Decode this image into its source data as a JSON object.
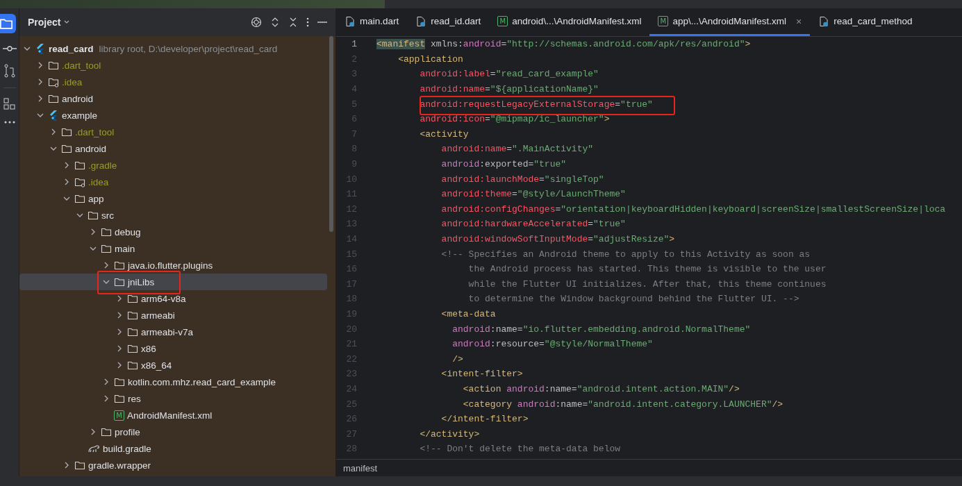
{
  "project_panel": {
    "title": "Project",
    "tree": [
      {
        "label": "read_card",
        "kind": "flutter",
        "detail": "library root, D:\\developer\\project\\read_card",
        "excluded": false,
        "expanded": true,
        "selected": false,
        "annotated": false,
        "children": [
          {
            "label": ".dart_tool",
            "kind": "folder",
            "excluded": true,
            "expanded": false,
            "selected": false,
            "annotated": false
          },
          {
            "label": ".idea",
            "kind": "folder-config",
            "excluded": true,
            "expanded": false,
            "selected": false,
            "annotated": false
          },
          {
            "label": "android",
            "kind": "folder",
            "excluded": false,
            "expanded": false,
            "selected": false,
            "annotated": false
          },
          {
            "label": "example",
            "kind": "flutter",
            "excluded": false,
            "expanded": true,
            "selected": false,
            "annotated": false,
            "children": [
              {
                "label": ".dart_tool",
                "kind": "folder",
                "excluded": true,
                "expanded": false,
                "selected": false,
                "annotated": false
              },
              {
                "label": "android",
                "kind": "folder",
                "excluded": false,
                "expanded": true,
                "selected": false,
                "annotated": false,
                "children": [
                  {
                    "label": ".gradle",
                    "kind": "folder",
                    "excluded": true,
                    "expanded": false,
                    "selected": false,
                    "annotated": false
                  },
                  {
                    "label": ".idea",
                    "kind": "folder-config",
                    "excluded": true,
                    "expanded": false,
                    "selected": false,
                    "annotated": false
                  },
                  {
                    "label": "app",
                    "kind": "folder",
                    "excluded": false,
                    "expanded": true,
                    "selected": false,
                    "annotated": false,
                    "children": [
                      {
                        "label": "src",
                        "kind": "folder",
                        "excluded": false,
                        "expanded": true,
                        "selected": false,
                        "annotated": false,
                        "children": [
                          {
                            "label": "debug",
                            "kind": "folder",
                            "excluded": false,
                            "expanded": false,
                            "selected": false,
                            "annotated": false
                          },
                          {
                            "label": "main",
                            "kind": "folder",
                            "excluded": false,
                            "expanded": true,
                            "selected": false,
                            "annotated": false,
                            "children": [
                              {
                                "label": "java.io.flutter.plugins",
                                "kind": "folder",
                                "excluded": false,
                                "expanded": false,
                                "selected": false,
                                "annotated": false
                              },
                              {
                                "label": "jniLibs",
                                "kind": "folder",
                                "excluded": false,
                                "expanded": true,
                                "selected": true,
                                "annotated": true,
                                "children": [
                                  {
                                    "label": "arm64-v8a",
                                    "kind": "folder",
                                    "excluded": false,
                                    "expanded": false,
                                    "selected": false,
                                    "annotated": false
                                  },
                                  {
                                    "label": "armeabi",
                                    "kind": "folder",
                                    "excluded": false,
                                    "expanded": false,
                                    "selected": false,
                                    "annotated": false
                                  },
                                  {
                                    "label": "armeabi-v7a",
                                    "kind": "folder",
                                    "excluded": false,
                                    "expanded": false,
                                    "selected": false,
                                    "annotated": false
                                  },
                                  {
                                    "label": "x86",
                                    "kind": "folder",
                                    "excluded": false,
                                    "expanded": false,
                                    "selected": false,
                                    "annotated": false
                                  },
                                  {
                                    "label": "x86_64",
                                    "kind": "folder",
                                    "excluded": false,
                                    "expanded": false,
                                    "selected": false,
                                    "annotated": false
                                  }
                                ]
                              },
                              {
                                "label": "kotlin.com.mhz.read_card_example",
                                "kind": "folder",
                                "excluded": false,
                                "expanded": false,
                                "selected": false,
                                "annotated": false
                              },
                              {
                                "label": "res",
                                "kind": "folder",
                                "excluded": false,
                                "expanded": false,
                                "selected": false,
                                "annotated": false
                              },
                              {
                                "label": "AndroidManifest.xml",
                                "kind": "manifest",
                                "badge": "M",
                                "excluded": false,
                                "selected": false,
                                "annotated": false
                              }
                            ]
                          },
                          {
                            "label": "profile",
                            "kind": "folder",
                            "excluded": false,
                            "expanded": false,
                            "selected": false,
                            "annotated": false
                          }
                        ]
                      },
                      {
                        "label": "build.gradle",
                        "kind": "gradle",
                        "excluded": false,
                        "selected": false,
                        "annotated": false
                      }
                    ]
                  },
                  {
                    "label": "gradle.wrapper",
                    "kind": "folder",
                    "excluded": false,
                    "expanded": false,
                    "selected": false,
                    "annotated": false
                  }
                ]
              }
            ]
          }
        ]
      }
    ]
  },
  "editor_tabs": [
    {
      "label": "main.dart",
      "kind": "dart",
      "selected": false
    },
    {
      "label": "read_id.dart",
      "kind": "dart",
      "selected": false
    },
    {
      "label": "android\\...\\AndroidManifest.xml",
      "kind": "manifest",
      "badge": "M",
      "selected": false
    },
    {
      "label": "app\\...\\AndroidManifest.xml",
      "kind": "manifest",
      "badge": "M",
      "selected": true,
      "close": "×"
    },
    {
      "label": "read_card_method",
      "kind": "dart",
      "selected": false
    }
  ],
  "code_lines": [
    {
      "number": "1",
      "current": true,
      "annotated": false,
      "tokens": [
        {
          "kind": "tagm",
          "text": "<manifest"
        },
        {
          "kind": "plain",
          "text": " xmlns:"
        },
        {
          "kind": "ns",
          "text": "android"
        },
        {
          "kind": "plain",
          "text": "="
        },
        {
          "kind": "str",
          "text": "\"http://schemas.android.com/apk/res/android\""
        },
        {
          "kind": "tag",
          "text": ">"
        }
      ]
    },
    {
      "number": "2",
      "current": false,
      "annotated": false,
      "tokens": [
        {
          "kind": "tag",
          "text": "    <application"
        }
      ]
    },
    {
      "number": "3",
      "current": false,
      "annotated": false,
      "tokens": [
        {
          "kind": "err",
          "text": "        android:label"
        },
        {
          "kind": "plain",
          "text": "="
        },
        {
          "kind": "str",
          "text": "\"read_card_example\""
        }
      ]
    },
    {
      "number": "4",
      "current": false,
      "annotated": false,
      "tokens": [
        {
          "kind": "err",
          "text": "        android:name"
        },
        {
          "kind": "plain",
          "text": "="
        },
        {
          "kind": "str",
          "text": "\"${applicationName}\""
        }
      ]
    },
    {
      "number": "5",
      "current": false,
      "annotated": true,
      "tokens": [
        {
          "kind": "err",
          "text": "        android:requestLegacyExternalStorage"
        },
        {
          "kind": "plain",
          "text": "="
        },
        {
          "kind": "str",
          "text": "\"true\""
        }
      ]
    },
    {
      "number": "6",
      "current": false,
      "annotated": false,
      "tokens": [
        {
          "kind": "err",
          "text": "        android:icon"
        },
        {
          "kind": "plain",
          "text": "="
        },
        {
          "kind": "str",
          "text": "\"@mipmap/ic_launcher\""
        },
        {
          "kind": "tag",
          "text": ">"
        }
      ]
    },
    {
      "number": "7",
      "current": false,
      "annotated": false,
      "tokens": [
        {
          "kind": "tag",
          "text": "        <activity"
        }
      ]
    },
    {
      "number": "8",
      "current": false,
      "annotated": false,
      "tokens": [
        {
          "kind": "err",
          "text": "            android:name"
        },
        {
          "kind": "plain",
          "text": "="
        },
        {
          "kind": "str",
          "text": "\".MainActivity\""
        }
      ]
    },
    {
      "number": "9",
      "current": false,
      "annotated": false,
      "tokens": [
        {
          "kind": "ns",
          "text": "            android"
        },
        {
          "kind": "plain",
          "text": ":exported="
        },
        {
          "kind": "str",
          "text": "\"true\""
        }
      ]
    },
    {
      "number": "10",
      "current": false,
      "annotated": false,
      "tokens": [
        {
          "kind": "err",
          "text": "            android:launchMode"
        },
        {
          "kind": "plain",
          "text": "="
        },
        {
          "kind": "str",
          "text": "\"singleTop\""
        }
      ]
    },
    {
      "number": "11",
      "current": false,
      "annotated": false,
      "tokens": [
        {
          "kind": "err",
          "text": "            android:theme"
        },
        {
          "kind": "plain",
          "text": "="
        },
        {
          "kind": "str",
          "text": "\"@style/LaunchTheme\""
        }
      ]
    },
    {
      "number": "12",
      "current": false,
      "annotated": false,
      "tokens": [
        {
          "kind": "err",
          "text": "            android:configChanges"
        },
        {
          "kind": "plain",
          "text": "="
        },
        {
          "kind": "str",
          "text": "\"orientation|keyboardHidden|keyboard|screenSize|smallestScreenSize|loca"
        }
      ]
    },
    {
      "number": "13",
      "current": false,
      "annotated": false,
      "tokens": [
        {
          "kind": "err",
          "text": "            android:hardwareAccelerated"
        },
        {
          "kind": "plain",
          "text": "="
        },
        {
          "kind": "str",
          "text": "\"true\""
        }
      ]
    },
    {
      "number": "14",
      "current": false,
      "annotated": false,
      "tokens": [
        {
          "kind": "err",
          "text": "            android:windowSoftInputMode"
        },
        {
          "kind": "plain",
          "text": "="
        },
        {
          "kind": "str",
          "text": "\"adjustResize\""
        },
        {
          "kind": "tag",
          "text": ">"
        }
      ]
    },
    {
      "number": "15",
      "current": false,
      "annotated": false,
      "tokens": [
        {
          "kind": "comment",
          "text": "            <!-- Specifies an Android theme to apply to this Activity as soon as"
        }
      ]
    },
    {
      "number": "16",
      "current": false,
      "annotated": false,
      "tokens": [
        {
          "kind": "comment",
          "text": "                 the Android process has started. This theme is visible to the user"
        }
      ]
    },
    {
      "number": "17",
      "current": false,
      "annotated": false,
      "tokens": [
        {
          "kind": "comment",
          "text": "                 while the Flutter UI initializes. After that, this theme continues"
        }
      ]
    },
    {
      "number": "18",
      "current": false,
      "annotated": false,
      "tokens": [
        {
          "kind": "comment",
          "text": "                 to determine the Window background behind the Flutter UI. -->"
        }
      ]
    },
    {
      "number": "19",
      "current": false,
      "annotated": false,
      "tokens": [
        {
          "kind": "tag",
          "text": "            <meta-data"
        }
      ]
    },
    {
      "number": "20",
      "current": false,
      "annotated": false,
      "tokens": [
        {
          "kind": "ns",
          "text": "              android"
        },
        {
          "kind": "plain",
          "text": ":name="
        },
        {
          "kind": "str",
          "text": "\"io.flutter.embedding.android.NormalTheme\""
        }
      ]
    },
    {
      "number": "21",
      "current": false,
      "annotated": false,
      "tokens": [
        {
          "kind": "ns",
          "text": "              android"
        },
        {
          "kind": "plain",
          "text": ":resource="
        },
        {
          "kind": "str",
          "text": "\"@style/NormalTheme\""
        }
      ]
    },
    {
      "number": "22",
      "current": false,
      "annotated": false,
      "tokens": [
        {
          "kind": "tag",
          "text": "              />"
        }
      ]
    },
    {
      "number": "23",
      "current": false,
      "annotated": false,
      "tokens": [
        {
          "kind": "tag",
          "text": "            <intent-filter>"
        }
      ]
    },
    {
      "number": "24",
      "current": false,
      "annotated": false,
      "tokens": [
        {
          "kind": "tag",
          "text": "                <action "
        },
        {
          "kind": "ns",
          "text": "android"
        },
        {
          "kind": "plain",
          "text": ":name="
        },
        {
          "kind": "str",
          "text": "\"android.intent.action.MAIN\""
        },
        {
          "kind": "tag",
          "text": "/>"
        }
      ]
    },
    {
      "number": "25",
      "current": false,
      "annotated": false,
      "tokens": [
        {
          "kind": "tag",
          "text": "                <category "
        },
        {
          "kind": "ns",
          "text": "android"
        },
        {
          "kind": "plain",
          "text": ":name="
        },
        {
          "kind": "str",
          "text": "\"android.intent.category.LAUNCHER\""
        },
        {
          "kind": "tag",
          "text": "/>"
        }
      ]
    },
    {
      "number": "26",
      "current": false,
      "annotated": false,
      "tokens": [
        {
          "kind": "tag",
          "text": "            </intent-filter>"
        }
      ]
    },
    {
      "number": "27",
      "current": false,
      "annotated": false,
      "tokens": [
        {
          "kind": "tag",
          "text": "        </activity>"
        }
      ]
    },
    {
      "number": "28",
      "current": false,
      "annotated": false,
      "tokens": [
        {
          "kind": "comment",
          "text": "        <!-- Don't delete the meta-data below"
        }
      ]
    }
  ],
  "breadcrumb": "manifest"
}
